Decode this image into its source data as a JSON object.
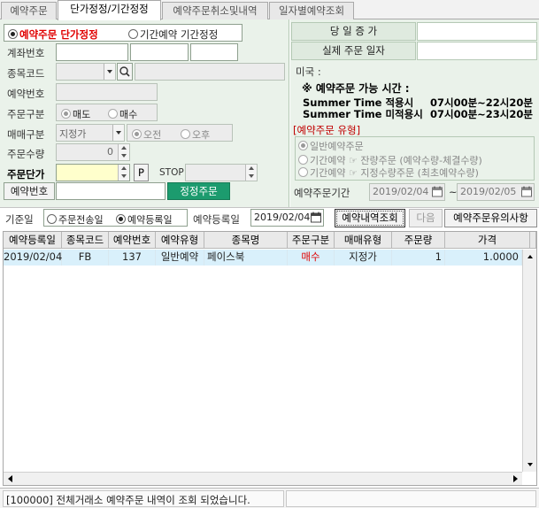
{
  "tabs": [
    "예약주문",
    "단가정정/기간정정",
    "예약주문취소및내역",
    "일자별예약조회"
  ],
  "mode_radio": {
    "option1": "예약주문 단가정정",
    "option2": "기간예약 기간정정"
  },
  "form": {
    "account_label": "계좌번호",
    "code_label": "종목코드",
    "resv_no_label": "예약번호",
    "order_type_label": "주문구분",
    "sell_label": "매도",
    "buy_label": "매수",
    "trade_type_label": "매매구분",
    "trade_type_value": "지정가",
    "am_label": "오전",
    "pm_label": "오후",
    "qty_label": "주문수량",
    "qty_value": "0",
    "price_label": "주문단가",
    "p_button": "P",
    "stop_label": "STOP",
    "resv_no2_label": "예약번호",
    "submit_button": "정정주문"
  },
  "right": {
    "today_deposit_label": "당 일 증 가",
    "actual_order_date_label": "실제 주문 일자",
    "us_label": "미국 :",
    "time_title": "※ 예약주문 가능 시간 :",
    "summer_on_label": "Summer Time 적용시",
    "summer_on_time": "07시00분~22시20분",
    "summer_off_label": "Summer Time 미적용시",
    "summer_off_time": "07시00분~23시20분",
    "resv_type_title": "[예약주문 유형]",
    "resv_type_opt1": "일반예약주문",
    "resv_type_opt2_a": "기간예약",
    "resv_type_opt2_b": "잔량주문 (예약수량-체결수량)",
    "resv_type_opt3_a": "기간예약",
    "resv_type_opt3_b": "지정수량주문 (최초예약수량)",
    "period_label": "예약주문기간",
    "period_from": "2019/02/04",
    "period_to": "2019/02/05",
    "tilde": "~"
  },
  "filter": {
    "basis_label": "기준일",
    "opt_send": "주문전송일",
    "opt_register": "예약등록일",
    "reg_date_label": "예약등록일",
    "reg_date_value": "2019/02/04",
    "query_button": "예약내역조회",
    "next_button": "다음",
    "notice_button": "예약주문유의사항"
  },
  "grid": {
    "headers": [
      "예약등록일",
      "종목코드",
      "예약번호",
      "예약유형",
      "종목명",
      "주문구분",
      "매매유형",
      "주문량",
      "가격"
    ],
    "rows": [
      [
        "2019/02/04",
        "FB",
        "137",
        "일반예약",
        "페이스북",
        "매수",
        "지정가",
        "1",
        "1.0000"
      ]
    ]
  },
  "status": {
    "message": "[100000] 전체거래소 예약주문 내역이 조회 되었습니다."
  },
  "colors": {
    "accent_red": "#e00000",
    "panel_green": "#eaf2ea",
    "submit_green": "#1c9b6e",
    "row_highlight": "#d9f0fb"
  }
}
